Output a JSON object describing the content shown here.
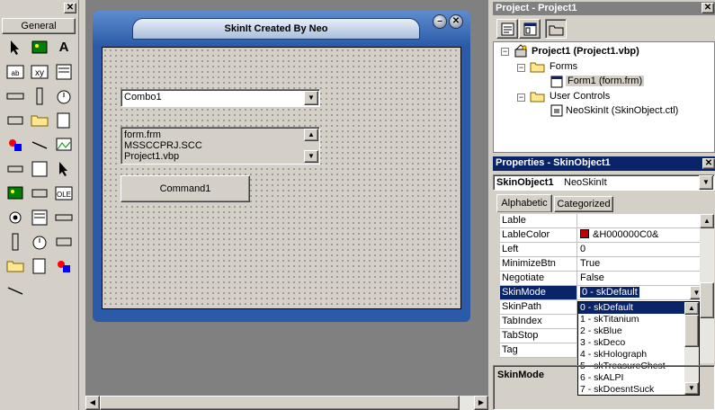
{
  "toolbox": {
    "title": "General",
    "tools": [
      {
        "icon": "pointer-icon"
      },
      {
        "icon": "picturebox-icon"
      },
      {
        "icon": "label-icon",
        "glyph": "A"
      },
      {
        "icon": "textbox-icon",
        "glyph": "ab|"
      },
      {
        "icon": "frame-icon",
        "glyph": "xy"
      },
      {
        "icon": "commandbutton-icon"
      },
      {
        "icon": "checkbox-icon"
      },
      {
        "icon": "optionbutton-icon"
      },
      {
        "icon": "combobox-icon"
      },
      {
        "icon": "listbox-icon"
      },
      {
        "icon": "hscrollbar-icon"
      },
      {
        "icon": "vscrollbar-icon"
      },
      {
        "icon": "timer-icon"
      },
      {
        "icon": "drivelistbox-icon"
      },
      {
        "icon": "dirlistbox-icon"
      },
      {
        "icon": "filelistbox-icon"
      },
      {
        "icon": "shape-icon"
      },
      {
        "icon": "line-icon"
      },
      {
        "icon": "image-icon"
      },
      {
        "icon": "data-icon"
      },
      {
        "icon": "ole-icon",
        "glyph": "OLE"
      },
      {
        "icon": "custom-1-icon"
      },
      {
        "icon": "custom-2-icon"
      },
      {
        "icon": "custom-3-icon"
      },
      {
        "icon": "custom-4-icon"
      },
      {
        "icon": "custom-5-icon"
      },
      {
        "icon": "custom-6-icon"
      },
      {
        "icon": "custom-7-icon"
      },
      {
        "icon": "custom-8-icon"
      },
      {
        "icon": "custom-9-icon"
      },
      {
        "icon": "neoskinit-icon"
      }
    ]
  },
  "form": {
    "title": "SkinIt Created By Neo",
    "combo_value": "Combo1",
    "list_items": [
      "form.frm",
      "MSSCCPRJ.SCC",
      "Project1.vbp"
    ],
    "command_label": "Command1"
  },
  "project": {
    "title": "Project - Project1",
    "root": "Project1 (Project1.vbp)",
    "forms_folder": "Forms",
    "form_file": "Form1 (form.frm)",
    "controls_folder": "User Controls",
    "control_file": "NeoSkinIt (SkinObject.ctl)"
  },
  "properties": {
    "title": "Properties - SkinObject1",
    "object_name": "SkinObject1",
    "object_type": "NeoSkinIt",
    "tab_alpha": "Alphabetic",
    "tab_cat": "Categorized",
    "rows": [
      {
        "name": "Lable",
        "value": ""
      },
      {
        "name": "LableColor",
        "value": "&H000000C0&",
        "swatch": "#c00000"
      },
      {
        "name": "Left",
        "value": "0"
      },
      {
        "name": "MinimizeBtn",
        "value": "True"
      },
      {
        "name": "Negotiate",
        "value": "False"
      },
      {
        "name": "SkinMode",
        "value": "0 - skDefault",
        "selected": true
      },
      {
        "name": "SkinPath",
        "value": ""
      },
      {
        "name": "TabIndex",
        "value": ""
      },
      {
        "name": "TabStop",
        "value": ""
      },
      {
        "name": "Tag",
        "value": ""
      }
    ],
    "dropdown_options": [
      "0 - skDefault",
      "1 - skTitanium",
      "2 - skBlue",
      "3 - skDeco",
      "4 - skHolograph",
      "5 - skTreasureChest",
      "6 - skALPI",
      "7 - skDoesntSuck"
    ],
    "description_title": "SkinMode"
  },
  "colors": {
    "titlebar": "#0a246a",
    "selection": "#0a246a",
    "skin_blue": "#2a5aa8"
  }
}
